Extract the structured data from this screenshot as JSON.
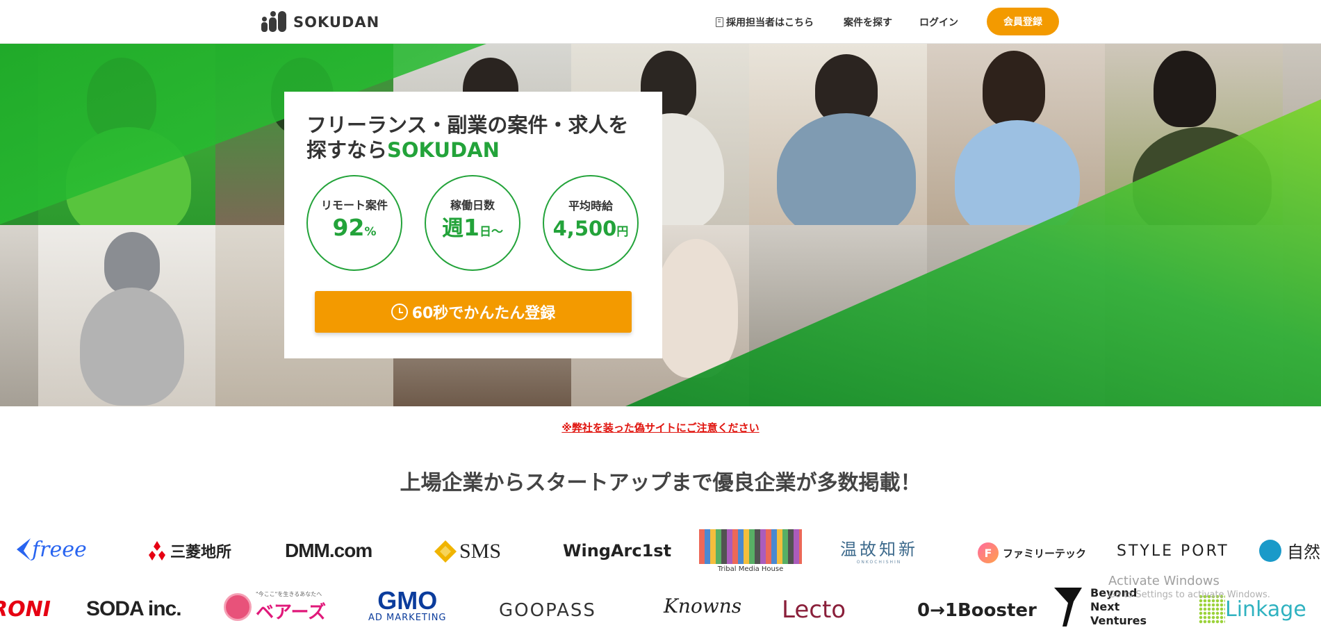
{
  "header": {
    "logo_text": "SOKUDAN",
    "nav": {
      "recruiter_label": "採用担当者はこちら",
      "search_label": "案件を探す",
      "login_label": "ログイン",
      "register_label": "会員登録"
    }
  },
  "hero": {
    "title_line1": "フリーランス・副業の案件・求人を",
    "title_line2_prefix": "探すなら",
    "title_line2_brand": "SOKUDAN",
    "stats": [
      {
        "label": "リモート案件",
        "prefix": "",
        "value": "92",
        "unit": "%"
      },
      {
        "label": "稼働日数",
        "prefix": "週",
        "value": "1",
        "unit": "日〜"
      },
      {
        "label": "平均時給",
        "prefix": "",
        "value": "4,500",
        "unit": "円"
      }
    ],
    "cta_label": "60秒でかんたん登録"
  },
  "warning_text": "※弊社を装った偽サイトにご注意ください",
  "section_title": "上場企業からスタートアップまで優良企業が多数掲載！",
  "companies_row1": [
    "freee",
    "三菱地所",
    "DMM.com",
    "SMS",
    "WingArc1st",
    "Tribal Media House",
    "温故知新",
    "ファミリーテック",
    "STYLE PORT",
    "自然"
  ],
  "companies_row2": [
    "RONI",
    "SODA inc.",
    "ベアーズ",
    "GMO AD MARKETING",
    "GOOPASS",
    "Knowns",
    "Lecto",
    "0→1Booster",
    "Beyond Next Ventures",
    "Linkage"
  ],
  "company_subtexts": {
    "tribal": "Tribal Media House",
    "bears_tag": "\"今ここ\"を生きるあなたへ",
    "gmo_sub": "AD MARKETING",
    "onko_sub": "ONKOCHISHIN"
  },
  "os_watermark": {
    "title": "Activate Windows",
    "subtitle": "Go to Settings to activate Windows."
  },
  "colors": {
    "brand_green": "#23a33a",
    "accent_orange": "#f39a00",
    "warning_red": "#e0140e"
  }
}
